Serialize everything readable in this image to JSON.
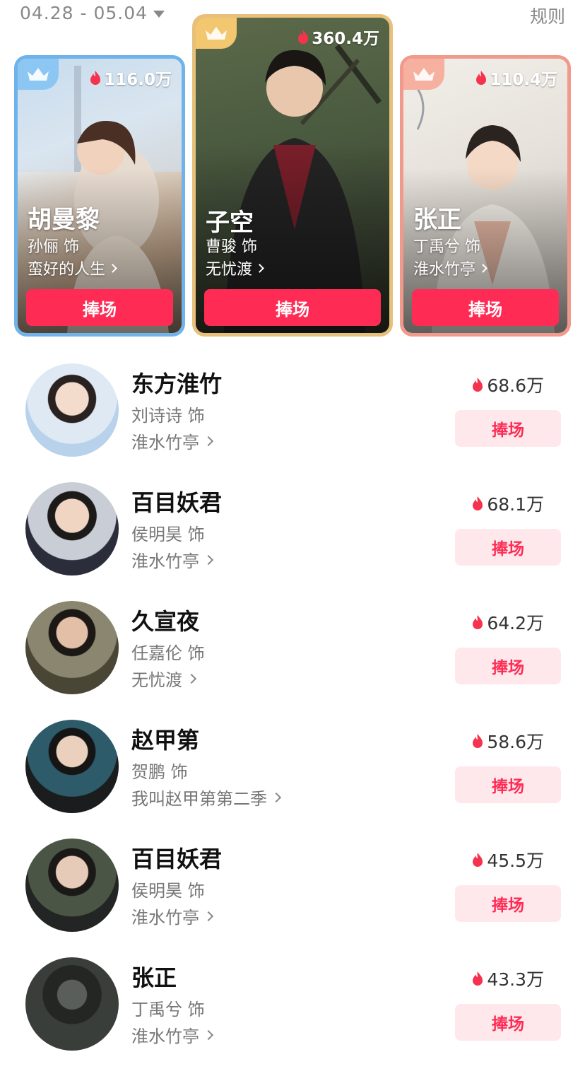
{
  "header": {
    "date_range": "04.28 - 05.04",
    "rules_label": "规则"
  },
  "podium": [
    {
      "rank": 2,
      "heat": "116.0万",
      "role": "胡曼黎",
      "actor": "孙俪 饰",
      "drama": "蛮好的人生",
      "cheer": "捧场",
      "border_color": "#6fb3ea",
      "crown_bg": "#8cc6f2"
    },
    {
      "rank": 1,
      "heat": "360.4万",
      "role": "子空",
      "actor": "曹骏 饰",
      "drama": "无忧渡",
      "cheer": "捧场",
      "border_color": "#e7c07b",
      "crown_bg": "#f2c76f"
    },
    {
      "rank": 3,
      "heat": "110.4万",
      "role": "张正",
      "actor": "丁禹兮 饰",
      "drama": "淮水竹亭",
      "cheer": "捧场",
      "border_color": "#f19a8c",
      "crown_bg": "#f6b0a0"
    }
  ],
  "list": [
    {
      "name": "东方淮竹",
      "actor": "刘诗诗 饰",
      "drama": "淮水竹亭",
      "heat": "68.6万",
      "cheer": "捧场"
    },
    {
      "name": "百目妖君",
      "actor": "侯明昊 饰",
      "drama": "淮水竹亭",
      "heat": "68.1万",
      "cheer": "捧场"
    },
    {
      "name": "久宣夜",
      "actor": "任嘉伦 饰",
      "drama": "无忧渡",
      "heat": "64.2万",
      "cheer": "捧场"
    },
    {
      "name": "赵甲第",
      "actor": "贺鹏 饰",
      "drama": "我叫赵甲第第二季",
      "heat": "58.6万",
      "cheer": "捧场"
    },
    {
      "name": "百目妖君",
      "actor": "侯明昊 饰",
      "drama": "淮水竹亭",
      "heat": "45.5万",
      "cheer": "捧场"
    },
    {
      "name": "张正",
      "actor": "丁禹兮 饰",
      "drama": "淮水竹亭",
      "heat": "43.3万",
      "cheer": "捧场"
    }
  ],
  "colors": {
    "accent": "#fe2c55",
    "flame": "#f5334f"
  }
}
